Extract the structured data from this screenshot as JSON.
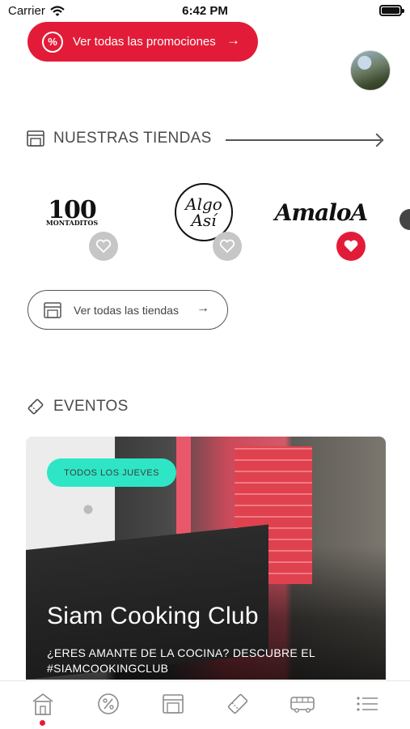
{
  "status_bar": {
    "carrier": "Carrier",
    "time": "6:42 PM"
  },
  "promo": {
    "label": "Ver todas las promociones",
    "icon": "percent-icon",
    "arrow": "→"
  },
  "profile": {
    "avatar": "user-avatar"
  },
  "stores_section": {
    "title": "NUESTRAS TIENDAS",
    "stores": [
      {
        "name": "100 Montaditos",
        "logo_text": "100",
        "logo_sub": "MONTADITOS",
        "favorite": false
      },
      {
        "name": "Algo Así",
        "logo_text": "Algo",
        "logo_text2": "Así",
        "favorite": false
      },
      {
        "name": "AmaloA",
        "logo_text": "AmaloA",
        "favorite": true
      }
    ],
    "see_all_label": "Ver todas las tiendas",
    "arrow": "→"
  },
  "events_section": {
    "title": "EVENTOS",
    "event": {
      "badge": "TODOS LOS JUEVES",
      "title": "Siam Cooking Club",
      "description_line1": "¿ERES AMANTE DE LA COCINA? DESCUBRE EL",
      "description_line2": "#SIAMCOOKINGCLUB"
    }
  },
  "tab_bar": {
    "items": [
      "home-icon",
      "promotions-icon",
      "stores-icon",
      "events-icon",
      "transport-icon",
      "menu-icon"
    ],
    "active": "home-icon"
  },
  "colors": {
    "accent": "#e21c38",
    "badge": "#2ee6c6",
    "text": "#4a4a4a"
  }
}
